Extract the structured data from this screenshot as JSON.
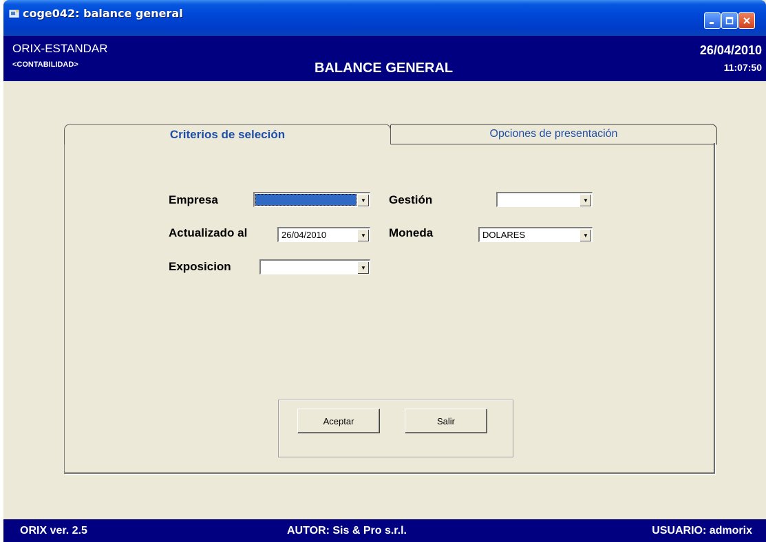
{
  "window": {
    "title": "coge042: balance general",
    "icon": "app-window-icon"
  },
  "header": {
    "company": "ORIX-ESTANDAR",
    "module": "<CONTABILIDAD>",
    "title": "BALANCE GENERAL",
    "date": "26/04/2010",
    "time": "11:07:50"
  },
  "tabs": [
    {
      "label": "Criterios de seleción",
      "active": true
    },
    {
      "label": "Opciones de presentación",
      "active": false
    }
  ],
  "form": {
    "empresa": {
      "label": "Empresa",
      "value": ""
    },
    "gestion": {
      "label": "Gestión",
      "value": ""
    },
    "actualizado": {
      "label": "Actualizado al",
      "value": "26/04/2010"
    },
    "moneda": {
      "label": "Moneda",
      "value": "DOLARES"
    },
    "exposicion": {
      "label": "Exposicion",
      "value": ""
    }
  },
  "buttons": {
    "accept": "Aceptar",
    "exit": "Salir"
  },
  "status": {
    "version": "ORIX ver. 2.5",
    "author": "AUTOR: Sis & Pro s.r.l.",
    "user": "USUARIO: admorix"
  },
  "colors": {
    "header_bg": "#000080",
    "window_bg": "#ece9d8",
    "tab_text": "#1f4ea8",
    "selection": "#316ac5"
  }
}
